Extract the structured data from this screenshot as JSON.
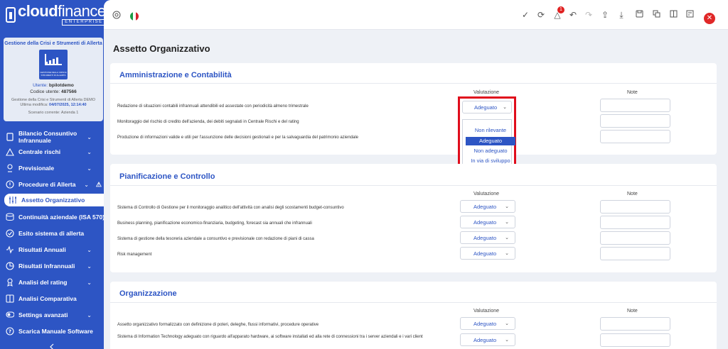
{
  "brand": {
    "name_bold": "cloud",
    "name_light": "finance",
    "sub": "ENTERPRISE"
  },
  "card": {
    "title": "Gestione della Crisi e Strumenti di Allerta",
    "image_caption": "GESTIONE DELLA CRISI E STRUMENTI DI ALLERTA",
    "user_label": "Utente:",
    "user_value": "bpilotdemo",
    "code_label": "Codice utente:",
    "code_value": "487566",
    "meta_line1": "Gestione della Crisi e Strumenti di Allerta DEMO",
    "meta_label": "Ultima modifica:",
    "meta_value": "04/07/2025, 12:14:40",
    "scenario": "Scenario corrente: Azienda 1"
  },
  "menu": [
    {
      "label": "Bilancio Consuntivo Infrannuale",
      "icon": "document-icon",
      "chevron": true
    },
    {
      "label": "Centrale rischi",
      "icon": "warning-icon",
      "chevron": true
    },
    {
      "label": "Previsionale",
      "icon": "pin-icon",
      "chevron": true
    },
    {
      "label": "Procedure di Allerta",
      "icon": "alert-circle-icon",
      "chevron": true,
      "warn": true
    },
    {
      "label": "Assetto Organizzativo",
      "icon": "sliders-icon",
      "active": true
    },
    {
      "label": "Continuità aziendale (ISA 570)",
      "icon": "database-icon"
    },
    {
      "label": "Esito sistema di allerta",
      "icon": "check-circle-icon"
    },
    {
      "label": "Risultati Annuali",
      "icon": "pulse-icon",
      "chevron": true
    },
    {
      "label": "Risultati Infrannuali",
      "icon": "pie-icon",
      "chevron": true
    },
    {
      "label": "Analisi del rating",
      "icon": "medal-icon",
      "chevron": true
    },
    {
      "label": "Analisi Comparativa",
      "icon": "columns-icon"
    },
    {
      "label": "Settings avanzati",
      "icon": "toggle-icon",
      "chevron": true
    },
    {
      "label": "Scarica Manuale Software",
      "icon": "help-icon"
    }
  ],
  "topbar": {
    "badge_count": "1"
  },
  "page_title": "Assetto Organizzativo",
  "columns": {
    "valutazione": "Valutazione",
    "note": "Note"
  },
  "sections": [
    {
      "title": "Amministrazione e Contabilità",
      "rows": [
        {
          "label": "Redazione di situazioni contabili infrannuali attendibili ed assestate con periodicità almeno trimestrale",
          "value": "Adeguato"
        },
        {
          "label": "Monitoraggio del rischio di credito dell'azienda, dei debiti segnalati in Centrale Rischi e del rating",
          "value": ""
        },
        {
          "label": "Produzione di informazioni valide e utili per l'assunzione delle decisioni gestionali e per la salvaguardia del patrimonio aziendale",
          "value": ""
        }
      ]
    },
    {
      "title": "Pianificazione e Controllo",
      "rows": [
        {
          "label": "Sistema di Controllo di Gestione per il monitoraggio analitico dell'attività con analisi degli scostamenti budget-consuntivo",
          "value": "Adeguato"
        },
        {
          "label": "Business planning, pianificazione economico-finanziaria, budgeting, forecast sia annuali che infrannuali",
          "value": "Adeguato"
        },
        {
          "label": "Sistema di gestione della tesoreria aziendale a consuntivo e previsionale con redazione di piani di cassa",
          "value": "Adeguato"
        },
        {
          "label": "Risk management",
          "value": "Adeguato"
        }
      ]
    },
    {
      "title": "Organizzazione",
      "rows": [
        {
          "label": "Assetto organizzativo formalizzato con definizione di poteri, deleghe, flussi informativi, procedure operative",
          "value": "Adeguato"
        },
        {
          "label": "Sistema di Information Technology adeguato con riguardo all'apparato hardware, ai software installati ed alla rete di connessioni tra i server aziendali e i vari client",
          "value": "Adeguato"
        }
      ]
    }
  ],
  "dropdown": {
    "selected": "Adeguato",
    "options": [
      "Non rilevante",
      "Adeguato",
      "Non adeguato",
      "In via di sviluppo"
    ],
    "highlight_index": 1
  },
  "colors": {
    "brand": "#2d55c4",
    "highlight_border": "#e00d1c",
    "close": "#e02828"
  }
}
